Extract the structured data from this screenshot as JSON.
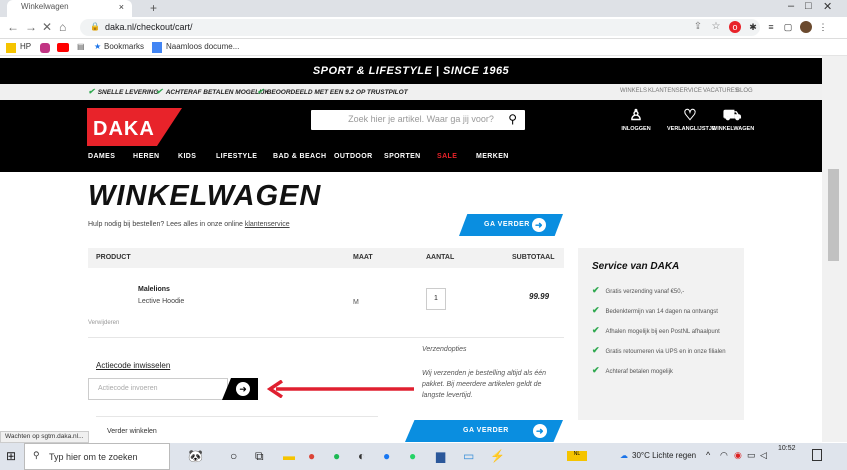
{
  "browser": {
    "tab_title": "Winkelwagen",
    "tab_close": "×",
    "new_tab": "+",
    "window_controls": [
      "–",
      "□",
      "✕"
    ],
    "url": "daka.nl/checkout/cart/",
    "bookmarks": [
      "HP",
      "Bookmarks",
      "Naamloos docume..."
    ],
    "status_text": "Wachten op sgtm.daka.nl..."
  },
  "site": {
    "top_banner": "SPORT & LIFESTYLE | SINCE 1965",
    "usps": [
      "SNELLE LEVERING",
      "ACHTERAF BETALEN MOGELIJK",
      "BEOORDEELD MET EEN 9.2 OP TRUSTPILOT"
    ],
    "top_links": [
      "WINKELS",
      "KLANTENSERVICE",
      "VACATURES",
      "BLOG"
    ],
    "logo_text": "DAKA",
    "search_placeholder": "Zoek hier je artikel. Waar ga jij voor?",
    "header_icons": [
      {
        "label": "INLOGGEN",
        "icon": "user-icon"
      },
      {
        "label": "VERLANGLIJSTJE",
        "icon": "heart-icon"
      },
      {
        "label": "WINKELWAGEN",
        "icon": "cart-icon"
      }
    ],
    "menu": [
      "DAMES",
      "HEREN",
      "KIDS",
      "LIFESTYLE",
      "BAD & BEACH",
      "OUTDOOR",
      "SPORTEN",
      "SALE",
      "MERKEN"
    ],
    "sale_color": "#e8232a"
  },
  "cart": {
    "title": "WINKELWAGEN",
    "help_text": "Hulp nodig bij bestellen? Lees alles in onze online ",
    "help_link": "klantenservice",
    "continue_label": "GA VERDER",
    "columns": [
      "PRODUCT",
      "MAAT",
      "AANTAL",
      "SUBTOTAAL"
    ],
    "item": {
      "brand": "Malelions",
      "name": "Lective Hoodie",
      "size": "M",
      "quantity": "1",
      "subtotal": "99.99",
      "remove": "Verwijderen"
    },
    "promo_link": "Actiecode inwisselen",
    "promo_placeholder": "Actiecode invoeren",
    "continue_shopping": "Verder winkelen",
    "shipping_title": "Verzendopties",
    "shipping_text": "Wij verzenden je bestelling altijd als één pakket. Bij meerdere artikelen geldt de langste levertijd."
  },
  "service": {
    "title": "Service van DAKA",
    "items": [
      "Gratis verzending vanaf €50,-",
      "Bedenktermijn van 14 dagen na ontvangst",
      "Afhalen mogelijk bij een PostNL afhaalpunt",
      "Gratis retourneren via UPS en in onze filialen",
      "Achteraf betalen mogelijk"
    ]
  },
  "taskbar": {
    "search": "Typ hier om te zoeken",
    "weather": "30°C Lichte regen",
    "time": "10:52"
  },
  "colors": {
    "accent_blue": "#0a8ee0",
    "logo_red": "#e8232a",
    "check_green": "#2fa84f"
  }
}
